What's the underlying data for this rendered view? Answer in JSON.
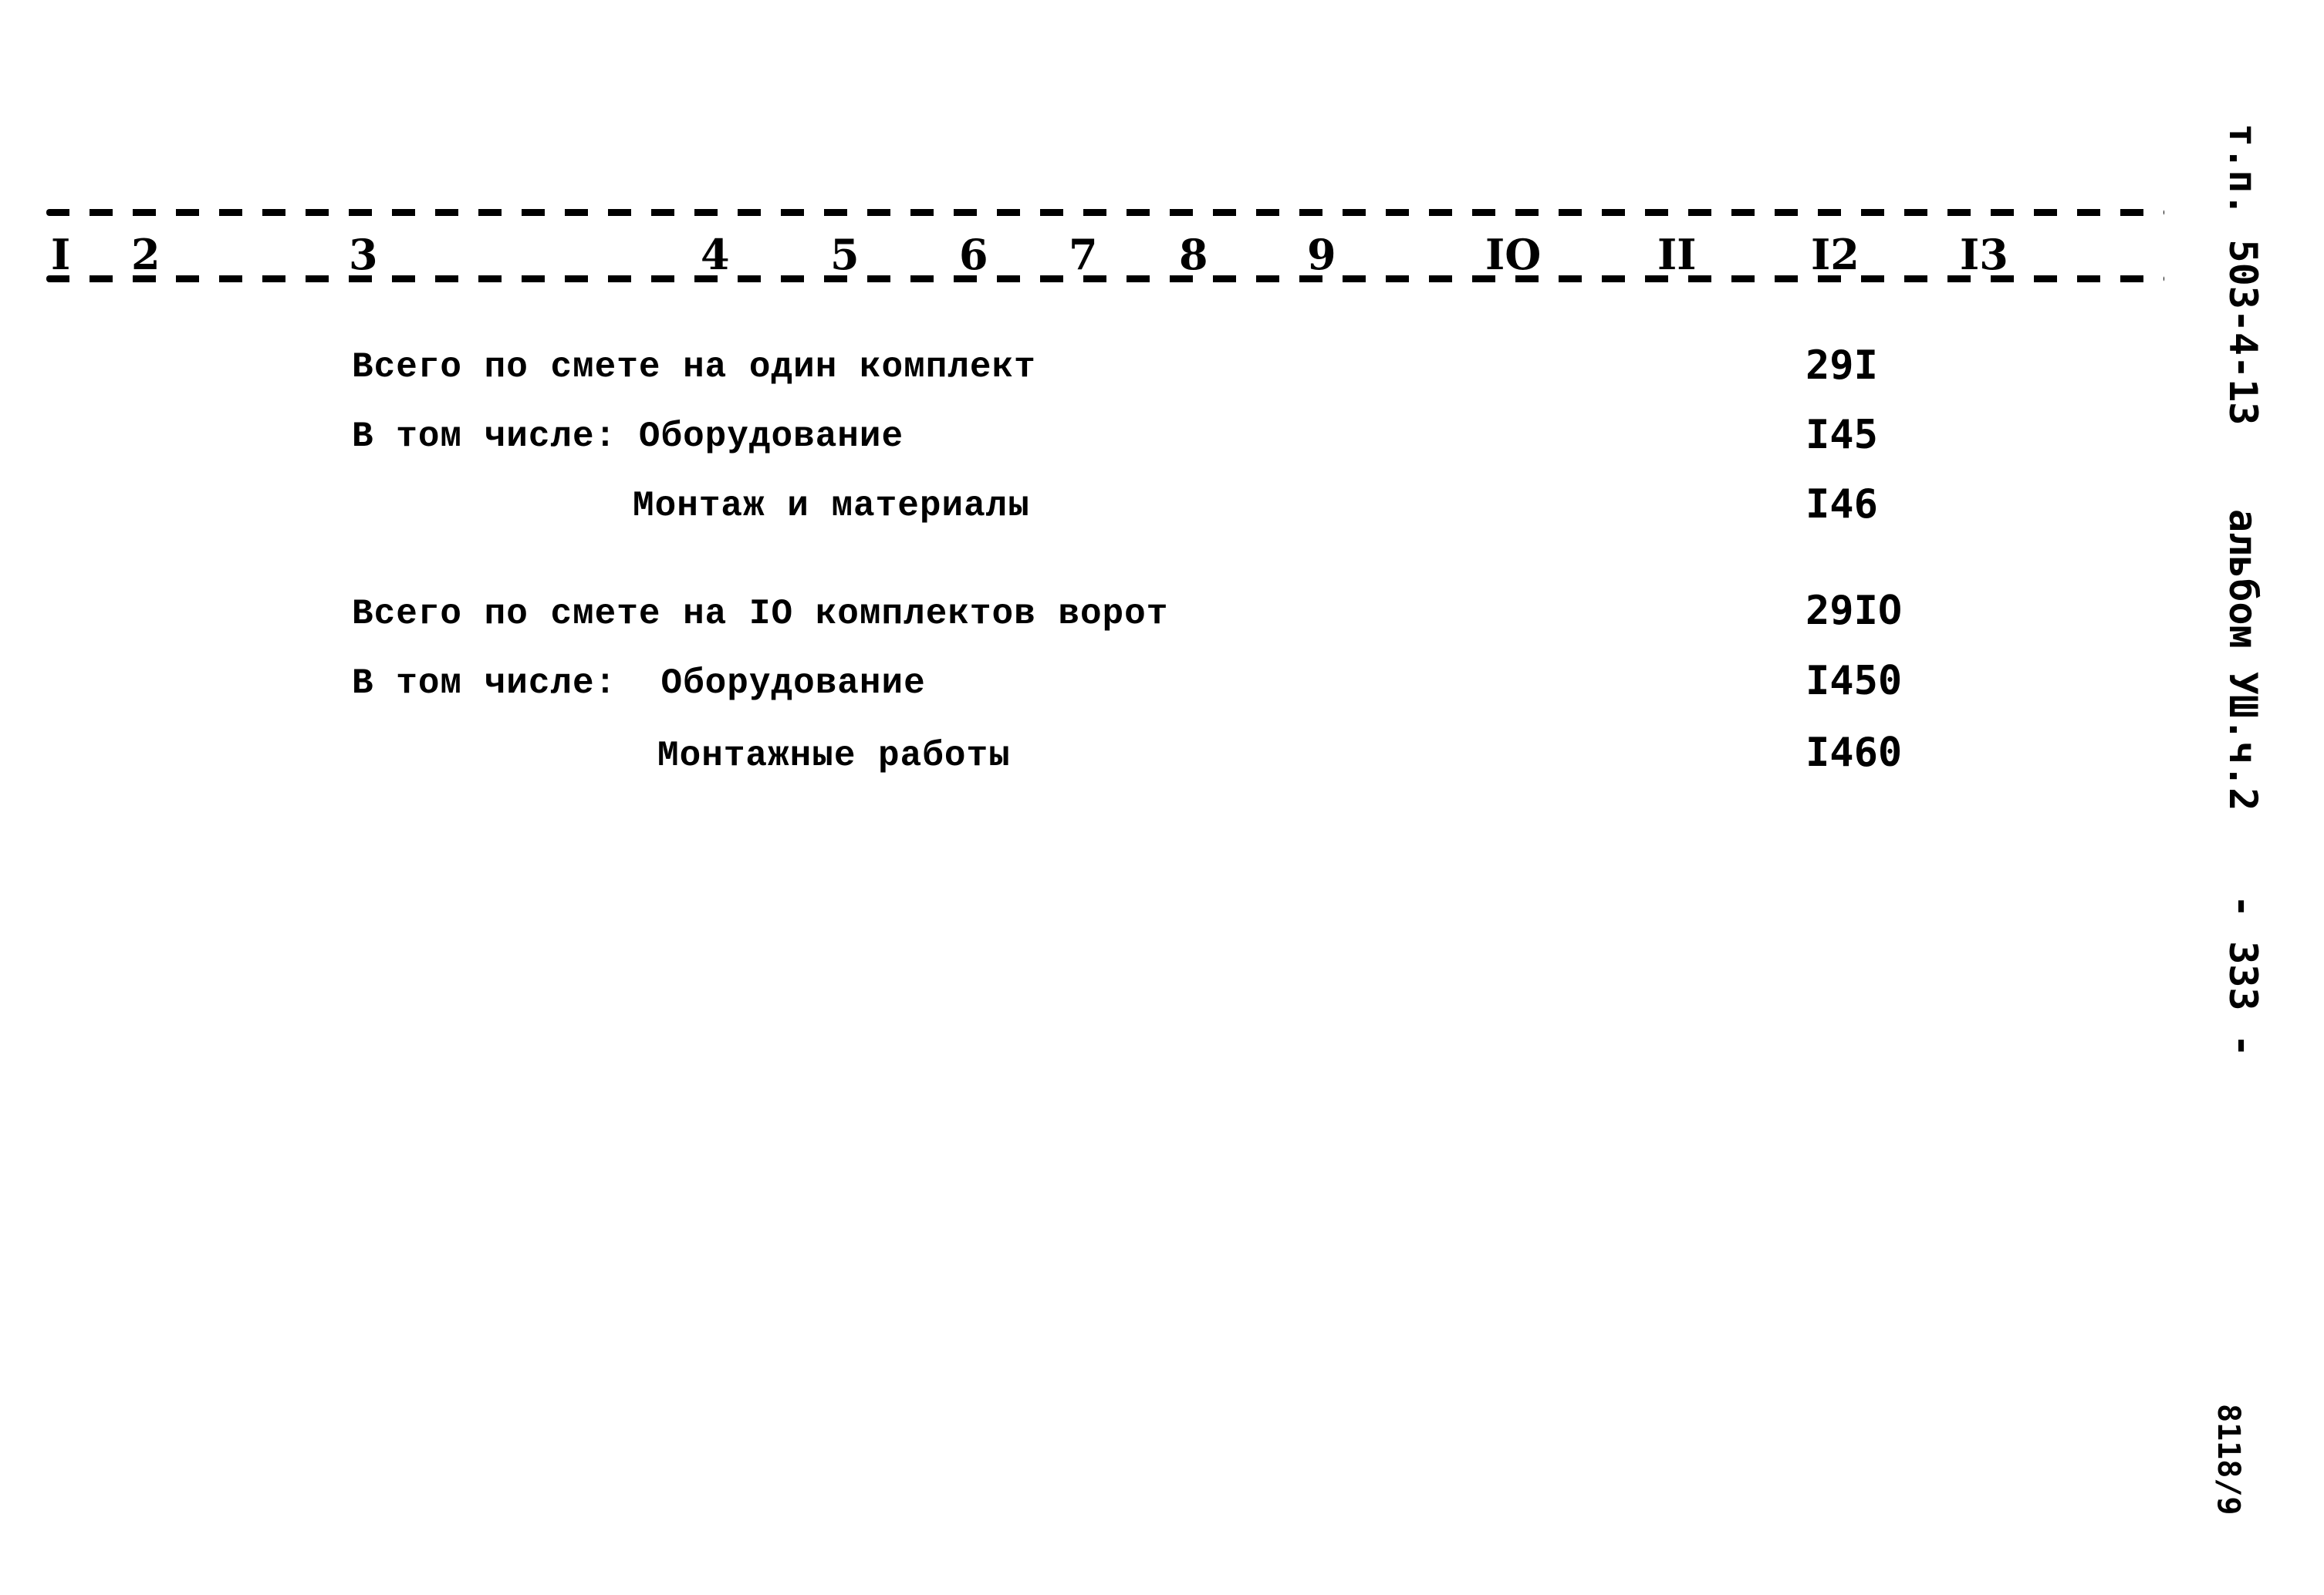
{
  "header": {
    "columns": [
      "I",
      "2",
      "3",
      "4",
      "5",
      "6",
      "7",
      "8",
      "9",
      "IO",
      "II",
      "I2",
      "I3"
    ]
  },
  "summary": {
    "per_set": {
      "label": "Всего по смете на один комплект",
      "value": "29I",
      "breakdown_prefix": "В том числе: Оборудование",
      "equipment_value": "I45",
      "installation_label": "Монтаж и материалы",
      "installation_value": "I46"
    },
    "ten_sets": {
      "label": "Всего по смете на IO комплектов ворот",
      "value": "29IO",
      "breakdown_prefix": "В том числе:  Оборудование",
      "equipment_value": "I450",
      "installation_label": "Монтажные работы",
      "installation_value": "I460"
    }
  },
  "margin": {
    "project_code": "т.п. 503-4-13",
    "album": "альбом УШ.ч.2",
    "page_number": "- 333 -",
    "stamp": "8118/9"
  }
}
